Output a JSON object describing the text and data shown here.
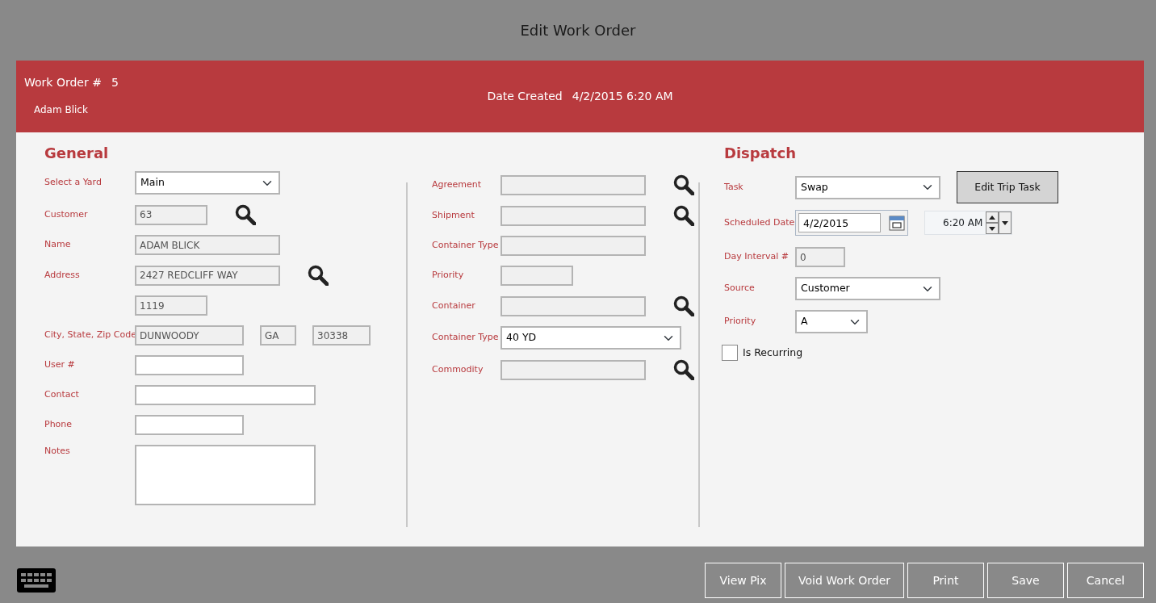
{
  "title": "Edit Work Order",
  "header": {
    "work_order_label": "Work Order #",
    "work_order_number": "5",
    "user": "Adam Blick",
    "date_label": "Date Created",
    "date_value": "4/2/2015 6:20 AM"
  },
  "general": {
    "heading": "General",
    "fields": [
      {
        "label": "Select a Yard",
        "kind": "select",
        "value": "Main"
      },
      {
        "label": "Customer",
        "kind": "input",
        "disabled": true,
        "value": "63",
        "lookup": true
      },
      {
        "label": "Name",
        "kind": "input",
        "disabled": true,
        "value": "ADAM BLICK"
      },
      {
        "label": "Address",
        "kind": "input",
        "disabled": true,
        "value": "2427 REDCLIFF WAY",
        "lookup": true
      },
      {
        "kind": "input",
        "disabled": true,
        "value": "1119"
      },
      {
        "label": "City, State, Zip Code",
        "kind": "multi",
        "inputs": [
          {
            "disabled": true,
            "value": "DUNWOODY"
          },
          {
            "disabled": true,
            "value": "GA"
          },
          {
            "disabled": true,
            "value": "30338"
          }
        ]
      },
      {
        "label": "User #",
        "kind": "input",
        "disabled": false
      },
      {
        "label": "Contact",
        "kind": "input",
        "disabled": false
      },
      {
        "label": "Phone",
        "kind": "input",
        "disabled": false
      },
      {
        "label": "Notes",
        "kind": "textarea",
        "disabled": false
      }
    ]
  },
  "middle": {
    "fields": [
      {
        "label": "Agreement",
        "kind": "input",
        "disabled": true,
        "lookup": true
      },
      {
        "label": "Shipment",
        "kind": "input",
        "disabled": true,
        "lookup": true
      },
      {
        "label": "Container Type",
        "kind": "input",
        "disabled": true
      },
      {
        "label": "Priority",
        "kind": "input",
        "disabled": true
      },
      {
        "label": "Container",
        "kind": "input",
        "disabled": true,
        "lookup": true
      },
      {
        "label": "Container Type",
        "kind": "select",
        "value": "40 YD"
      },
      {
        "label": "Commodity",
        "kind": "input",
        "disabled": true,
        "lookup": true
      }
    ]
  },
  "dispatch": {
    "heading": "Dispatch",
    "fields": [
      {
        "label": "Task",
        "kind": "select",
        "value": "Swap",
        "button": "Edit Trip Task"
      },
      {
        "label": "Scheduled Date",
        "kind": "datetime",
        "value": "4/2/2015",
        "time": "6:20 AM"
      },
      {
        "label": "Day Interval #",
        "kind": "input",
        "disabled": true,
        "value": "0"
      },
      {
        "label": "Source",
        "kind": "select",
        "value": "Customer"
      },
      {
        "label": "Priority",
        "kind": "select",
        "value": "A"
      },
      {
        "label": "Is Recurring",
        "kind": "checkbox",
        "checked": false
      }
    ]
  },
  "footer": {
    "buttons": [
      "View Pix",
      "Void Work Order",
      "Print",
      "Save",
      "Cancel"
    ]
  }
}
